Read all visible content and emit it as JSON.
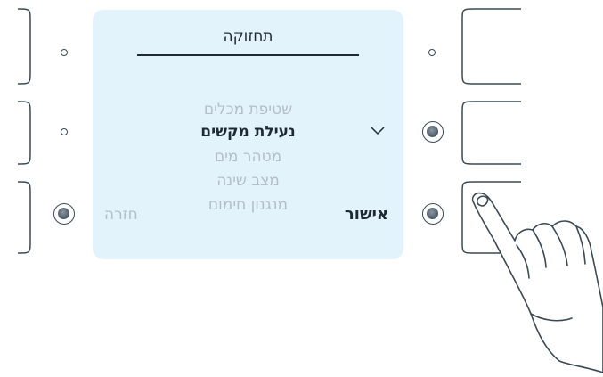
{
  "screen": {
    "title": "תחזוקה",
    "menu_items": [
      {
        "label": "שטיפת מכלים",
        "selected": false
      },
      {
        "label": "נעילת מקשים",
        "selected": true
      },
      {
        "label": "מטהר מים",
        "selected": false
      },
      {
        "label": "מצב שינה",
        "selected": false
      },
      {
        "label": "מנגנון חימום",
        "selected": false
      }
    ],
    "confirm_label": "אישור",
    "back_label": "חזרה"
  },
  "colors": {
    "display_bg": "#e3f3fc",
    "active_text": "#1f2b34",
    "inactive_text": "#b3bfc8",
    "outline": "#3a4a55"
  },
  "icons": {
    "selector": "chevron-down-icon",
    "hand": "pointing-hand-icon"
  }
}
